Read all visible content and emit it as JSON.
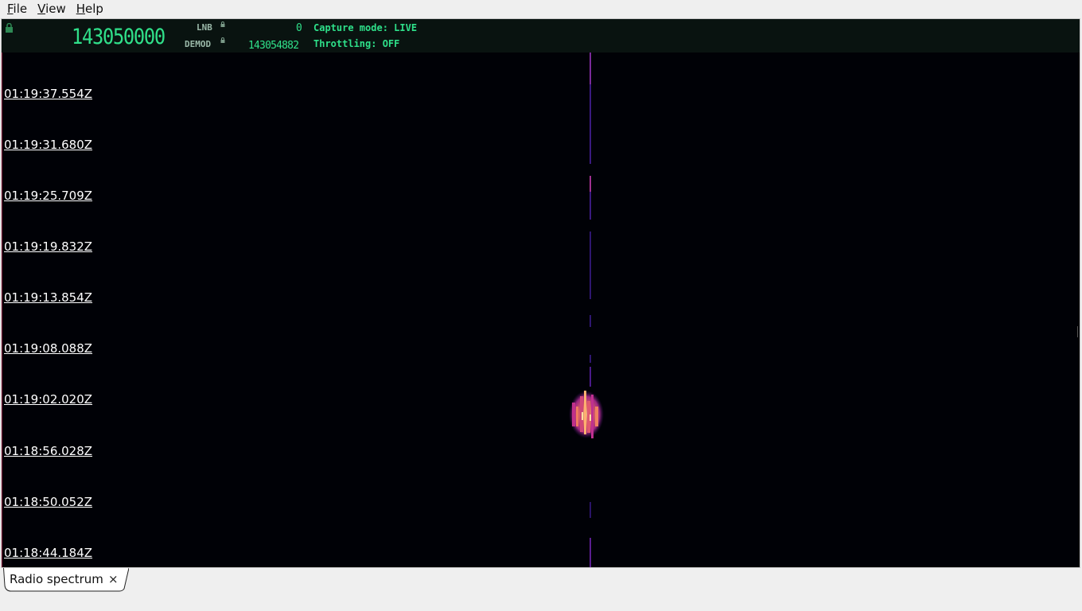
{
  "menu": {
    "items": [
      {
        "label": "File",
        "mnemonic": "F",
        "rest": "ile"
      },
      {
        "label": "View",
        "mnemonic": "V",
        "rest": "iew"
      },
      {
        "label": "Help",
        "mnemonic": "H",
        "rest": "elp"
      }
    ]
  },
  "header": {
    "main_frequency": "143050000",
    "lnb_label": "LNB",
    "lnb_value": "0",
    "demod_label": "DEMOD",
    "demod_value": "143054882",
    "capture_mode": "Capture mode: LIVE",
    "throttling": "Throttling: OFF"
  },
  "waterfall": {
    "timestamps": [
      "01:19:37.554Z",
      "01:19:31.680Z",
      "01:19:25.709Z",
      "01:19:19.832Z",
      "01:19:13.854Z",
      "01:19:08.088Z",
      "01:19:02.020Z",
      "01:18:56.028Z",
      "01:18:50.052Z",
      "01:18:44.184Z"
    ]
  },
  "tabs": [
    {
      "label": "Radio spectrum",
      "close_icon": "close-icon"
    }
  ],
  "colors": {
    "accent_green": "#30e08a",
    "waterfall_background": "#000106",
    "signal_low": "#4a1a8a",
    "signal_mid": "#c0308a",
    "signal_high": "#ffc070"
  }
}
